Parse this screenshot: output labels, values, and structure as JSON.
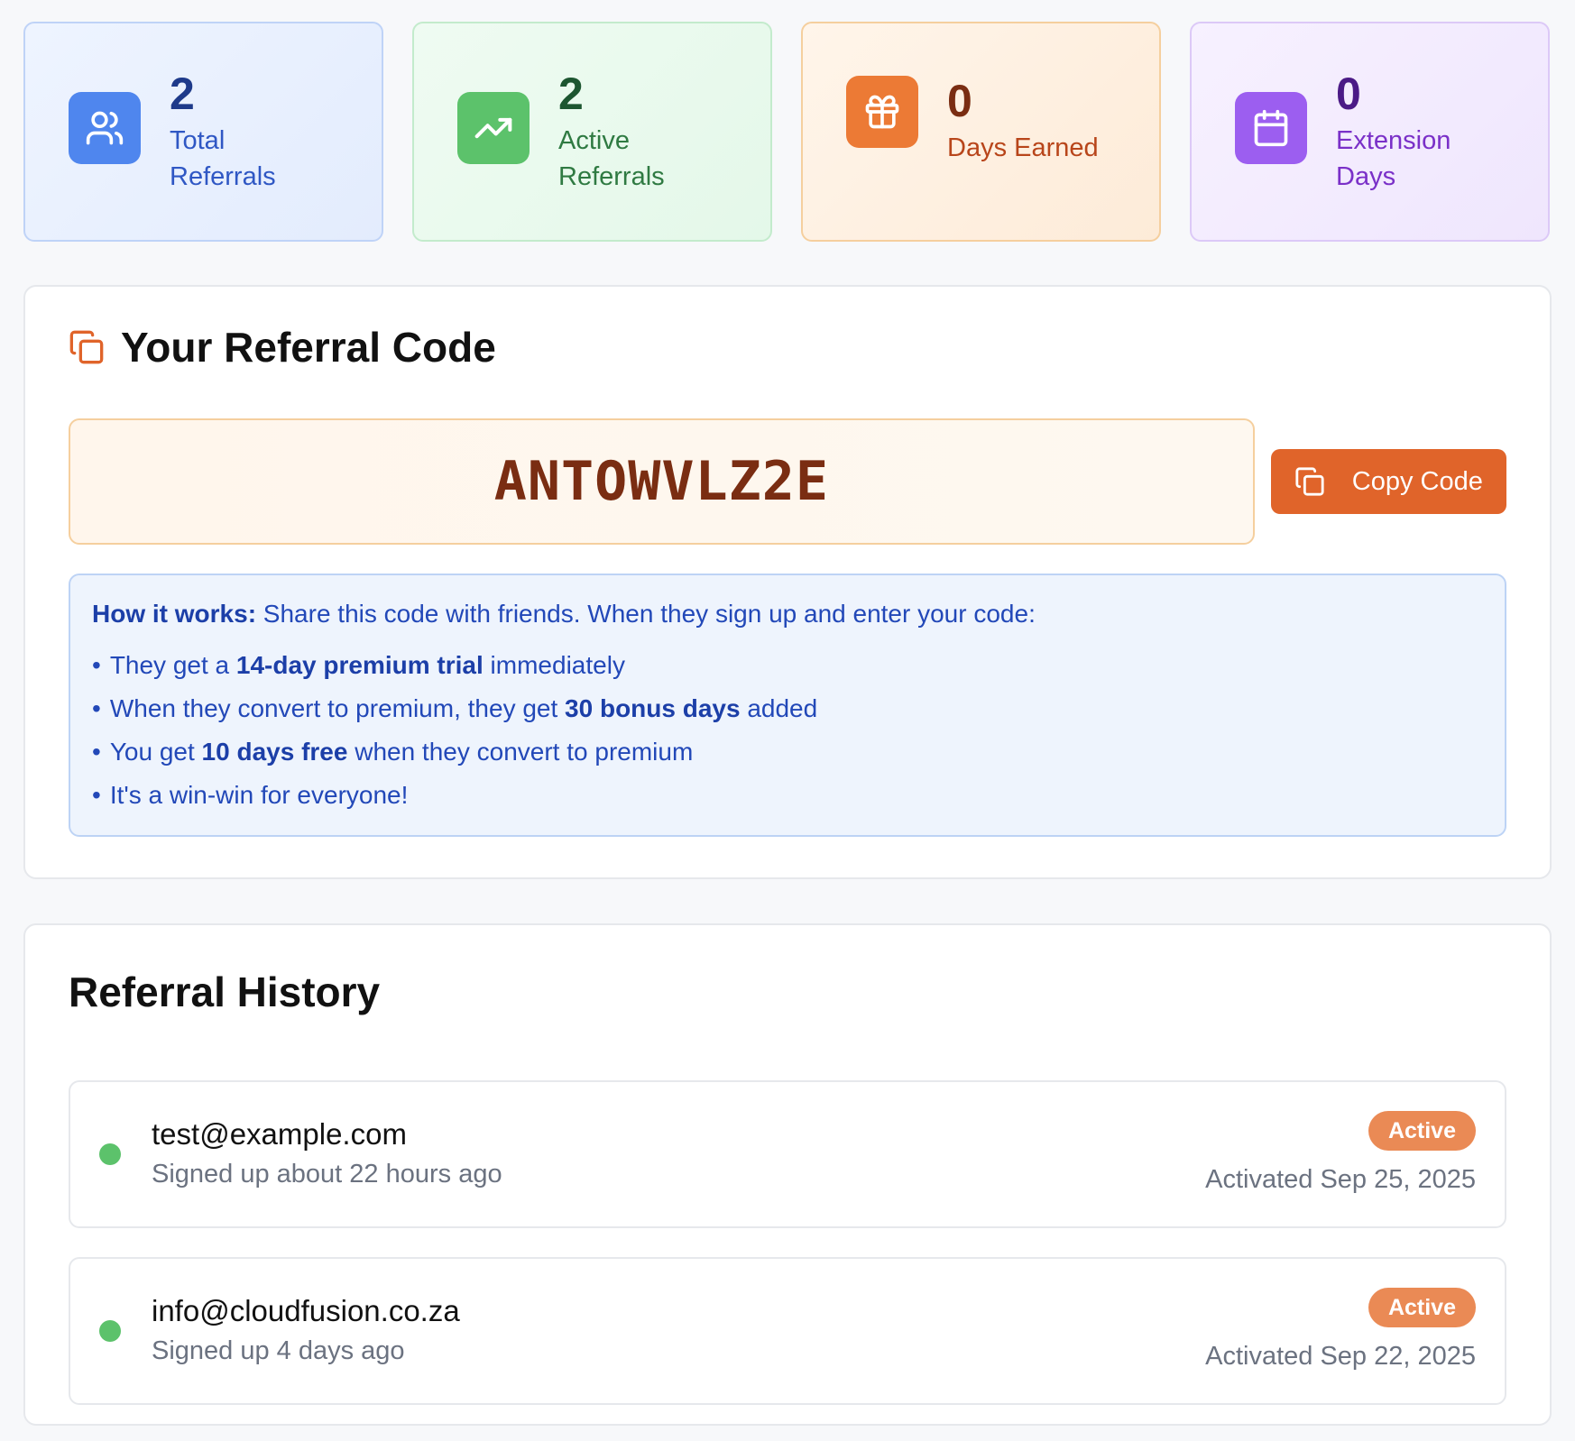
{
  "stats": [
    {
      "value": "2",
      "label": "Total Referrals",
      "icon": "users-icon",
      "color": "#4f86ee"
    },
    {
      "value": "2",
      "label": "Active Referrals",
      "icon": "trending-up-icon",
      "color": "#5cc26b"
    },
    {
      "value": "0",
      "label": "Days Earned",
      "icon": "gift-icon",
      "color": "#ec7a35"
    },
    {
      "value": "0",
      "label": "Extension Days",
      "icon": "calendar-icon",
      "color": "#9c5ef0"
    }
  ],
  "referral_code": {
    "title": "Your Referral Code",
    "title_icon": "copy-icon",
    "code": "ANTOWVLZ2E",
    "copy_label": "Copy Code",
    "accent": "#e0642a"
  },
  "how_it_works": {
    "lead_bold": "How it works:",
    "lead_text": " Share this code with friends. When they sign up and enter your code:",
    "items": [
      {
        "pre": "They get a ",
        "bold": "14-day premium trial",
        "post": " immediately"
      },
      {
        "pre": "When they convert to premium, they get ",
        "bold": "30 bonus days",
        "post": " added"
      },
      {
        "pre": "You get ",
        "bold": "10 days free",
        "post": " when they convert to premium"
      },
      {
        "pre": "It's a win-win for everyone!",
        "bold": "",
        "post": ""
      }
    ]
  },
  "history": {
    "title": "Referral History",
    "items": [
      {
        "email": "test@example.com",
        "signed_up": "Signed up about 22 hours ago",
        "status": "Active",
        "activated": "Activated Sep 25, 2025"
      },
      {
        "email": "info@cloudfusion.co.za",
        "signed_up": "Signed up 4 days ago",
        "status": "Active",
        "activated": "Activated Sep 22, 2025"
      }
    ]
  }
}
